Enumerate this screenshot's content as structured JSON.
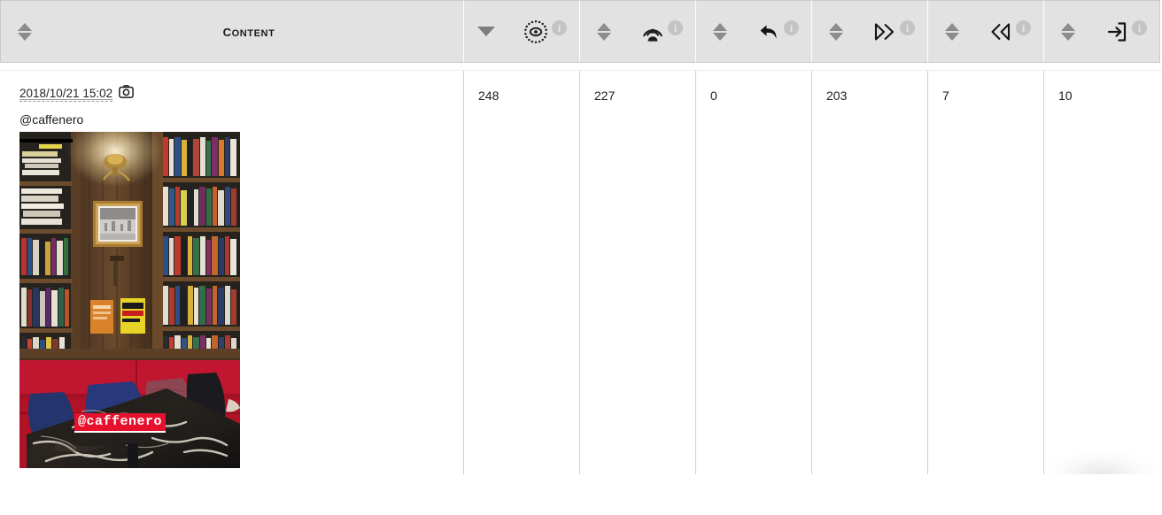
{
  "table": {
    "columns": [
      {
        "key": "content",
        "label": "Content",
        "type": "text",
        "sort_state": "none",
        "has_info": false
      },
      {
        "key": "impressions",
        "icon": "eye-dotted-icon",
        "label": "",
        "type": "metric",
        "sort_state": "desc",
        "has_info": true,
        "info_label": "i"
      },
      {
        "key": "reach",
        "icon": "broadcast-person-icon",
        "label": "",
        "type": "metric",
        "sort_state": "none",
        "has_info": true,
        "info_label": "i"
      },
      {
        "key": "replies",
        "icon": "reply-arrow-icon",
        "label": "",
        "type": "metric",
        "sort_state": "none",
        "has_info": true,
        "info_label": "i"
      },
      {
        "key": "forward",
        "icon": "chevron-double-right-icon",
        "label": "",
        "type": "metric",
        "sort_state": "none",
        "has_info": true,
        "info_label": "i"
      },
      {
        "key": "back",
        "icon": "chevron-double-left-icon",
        "label": "",
        "type": "metric",
        "sort_state": "none",
        "has_info": true,
        "info_label": "i"
      },
      {
        "key": "exits",
        "icon": "arrow-into-box-icon",
        "label": "",
        "type": "metric",
        "sort_state": "none",
        "has_info": true,
        "info_label": "i"
      }
    ],
    "rows": [
      {
        "date": "2018/10/21 15:02",
        "media_type_icon": "camera-icon",
        "account": "@caffenero",
        "photo_watermark": "@caffenero",
        "photo_alt": "bookshop cafe interior with wooden bookshelves, red bench seating, navy cushions and black marble table",
        "impressions": "248",
        "reach": "227",
        "replies": "0",
        "forward": "203",
        "back": "7",
        "exits": "10"
      }
    ]
  },
  "colors": {
    "header_bg": "#e2e2e2",
    "header_border": "#c9c9c9",
    "cell_divider": "#cfcfcf",
    "sort_arrow": "#8c8c8c",
    "info_badge": "#c4c4c4",
    "text": "#1d1d1d",
    "watermark_bg": "#e8112d",
    "watermark_text": "#ffffff"
  }
}
